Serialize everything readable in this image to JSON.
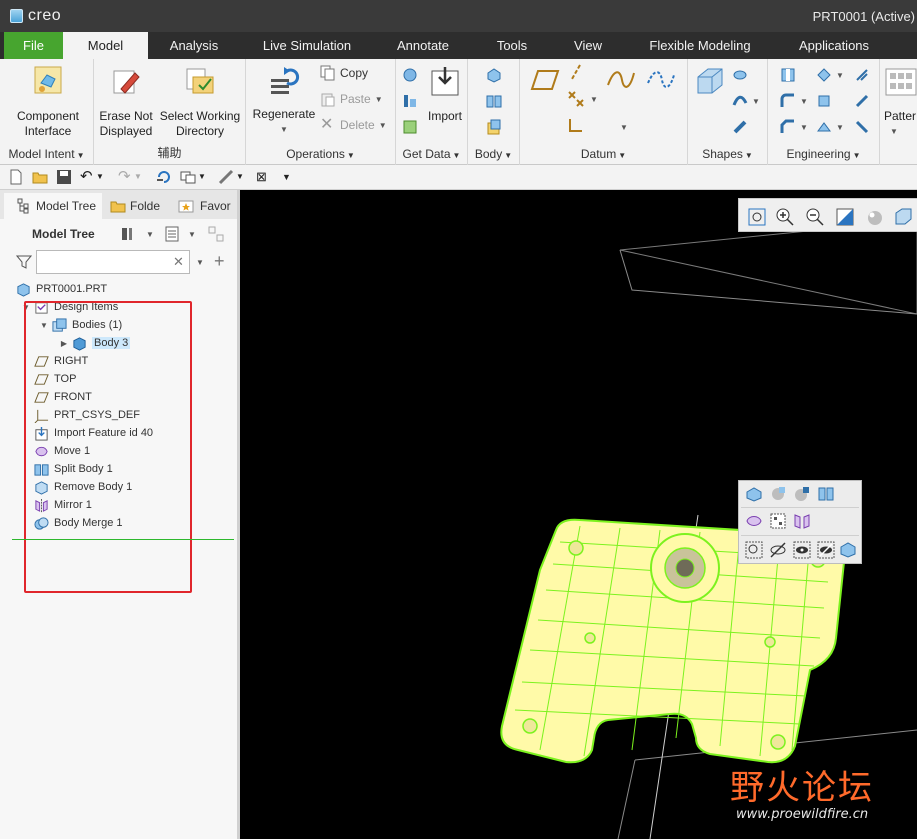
{
  "app": {
    "logo_text": "creo",
    "window_title": "PRT0001 (Active)"
  },
  "ribbon_tabs": [
    "File",
    "Model",
    "Analysis",
    "Live Simulation",
    "Annotate",
    "Tools",
    "View",
    "Flexible Modeling",
    "Applications"
  ],
  "ribbon": {
    "model_intent": {
      "component_interface": "Component Interface",
      "label": "Model Intent"
    },
    "aux": {
      "erase_not_displayed": "Erase Not Displayed",
      "select_working_directory": "Select Working Directory",
      "label": "辅助"
    },
    "operations": {
      "regenerate": "Regenerate",
      "copy": "Copy",
      "paste": "Paste",
      "delete": "Delete",
      "label": "Operations"
    },
    "get_data": {
      "import": "Import",
      "label": "Get Data"
    },
    "body": {
      "label": "Body"
    },
    "datum": {
      "label": "Datum"
    },
    "shapes": {
      "label": "Shapes"
    },
    "engineering": {
      "label": "Engineering"
    },
    "pattern": {
      "label": "Patter"
    }
  },
  "panel_tabs": [
    "Model Tree",
    "Folde",
    "Favor"
  ],
  "model_tree": {
    "title": "Model Tree",
    "search_value": "",
    "root": "PRT0001.PRT",
    "nodes": [
      {
        "label": "Design Items"
      },
      {
        "label": "Bodies (1)"
      },
      {
        "label": "Body 3"
      },
      {
        "label": "RIGHT"
      },
      {
        "label": "TOP"
      },
      {
        "label": "FRONT"
      },
      {
        "label": "PRT_CSYS_DEF"
      },
      {
        "label": "Import Feature id 40"
      },
      {
        "label": "Move 1"
      },
      {
        "label": "Split Body 1"
      },
      {
        "label": "Remove Body 1"
      },
      {
        "label": "Mirror 1"
      },
      {
        "label": "Body Merge 1"
      }
    ]
  },
  "watermark": {
    "cn": "野火论坛",
    "url": "www.proewildfire.cn"
  },
  "colors": {
    "file_tab": "#47a52f",
    "model_fill": "#fffaa8",
    "model_edge": "#7cf21e",
    "annotation_box": "#e0262c",
    "insert_line": "#2db82d"
  }
}
